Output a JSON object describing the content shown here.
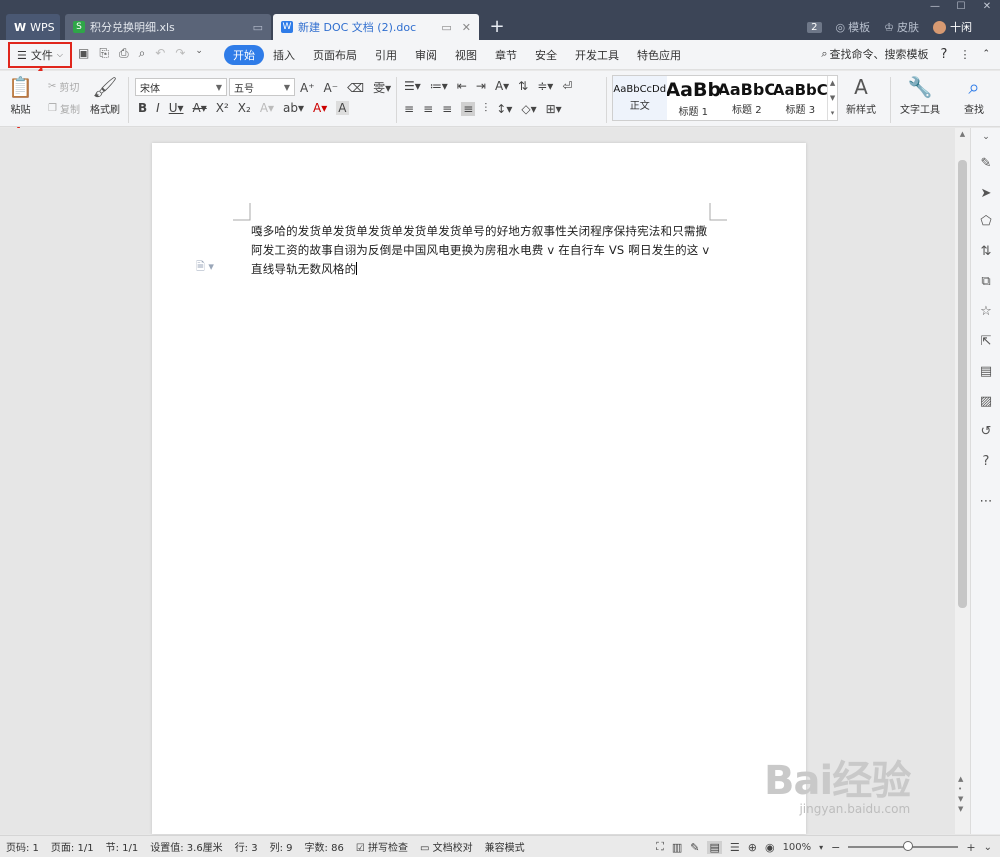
{
  "titlebar": {
    "tabs": [
      {
        "label": "WPS"
      },
      {
        "label": "积分兑换明细.xls"
      },
      {
        "label": "新建 DOC 文档 (2).doc"
      }
    ],
    "badge": "2",
    "template_label": "模板",
    "skin_label": "皮肤",
    "user_name": "十闲"
  },
  "menubar": {
    "file_label": "文件",
    "tabs": [
      "开始",
      "插入",
      "页面布局",
      "引用",
      "审阅",
      "视图",
      "章节",
      "安全",
      "开发工具",
      "特色应用"
    ],
    "active_tab": "开始",
    "search_label": "查找命令、搜索模板",
    "help_label": "?"
  },
  "ribbon": {
    "paste_label": "粘贴",
    "cut_label": "剪切",
    "copy_label": "复制",
    "format_painter_label": "格式刷",
    "font_name": "宋体",
    "font_size": "五号",
    "styles": [
      {
        "preview": "AaBbCcDd",
        "name": "正文"
      },
      {
        "preview": "AaBb",
        "name": "标题 1"
      },
      {
        "preview": "AaBbC",
        "name": "标题 2"
      },
      {
        "preview": "AaBbC",
        "name": "标题 3"
      }
    ],
    "new_style_label": "新样式",
    "text_tools_label": "文字工具",
    "find_label": "查找"
  },
  "document": {
    "text": "嘎多哈的发货单发货单发货单发货单发货单号的好地方叙事性关闭程序保持宪法和只需撒阿发工资的故事自诩为反倒是中国风电更换为房租水电费 v 在自行车 VS 啊日发生的这 v 直线导轨无数风格的"
  },
  "statusbar": {
    "page_no": "页码: 1",
    "pages": "页面: 1/1",
    "section": "节: 1/1",
    "setting": "设置值: 3.6厘米",
    "row": "行: 3",
    "col": "列: 9",
    "word_count": "字数: 86",
    "spell_check": "拼写检查",
    "doc_proof": "文档校对",
    "compat_mode": "兼容模式",
    "zoom": "100%"
  },
  "watermark": {
    "logo": "Bai经验",
    "url": "jingyan.baidu.com"
  },
  "colors": {
    "accent": "#2f7ce8",
    "titlebar": "#3c4557",
    "highlight_box": "#e0261c"
  }
}
